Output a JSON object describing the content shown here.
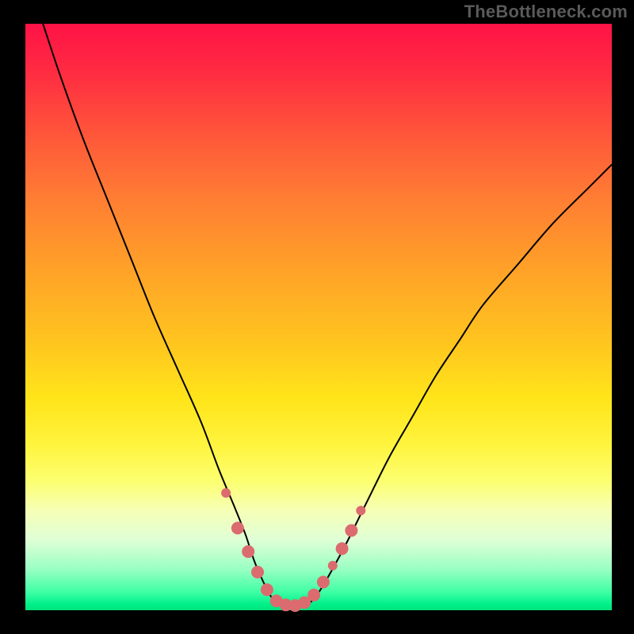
{
  "attribution": "TheBottleneck.com",
  "chart_data": {
    "type": "line",
    "title": "",
    "xlabel": "",
    "ylabel": "",
    "xlim": [
      0,
      100
    ],
    "ylim": [
      0,
      100
    ],
    "grid": false,
    "legend": false,
    "series": [
      {
        "name": "bottleneck-curve",
        "x": [
          3,
          6,
          10,
          14,
          18,
          22,
          26,
          30,
          33,
          35.5,
          37.5,
          39,
          40.5,
          42,
          44,
          46,
          48,
          50,
          54,
          58,
          62,
          66,
          70,
          74,
          78,
          84,
          90,
          96,
          100
        ],
        "y": [
          100,
          91,
          80,
          70,
          60,
          50,
          41,
          32,
          24,
          18,
          13,
          8.5,
          5,
          2.2,
          0.8,
          0.6,
          1.0,
          3.0,
          10,
          18,
          26,
          33,
          40,
          46,
          52,
          59,
          66,
          72,
          76
        ],
        "color": "#000000",
        "stroke_width": 2
      }
    ],
    "markers": [
      {
        "x": 34.2,
        "y": 20,
        "r": 6,
        "color": "#db6b6f"
      },
      {
        "x": 36.2,
        "y": 14,
        "r": 8,
        "color": "#db6b6f"
      },
      {
        "x": 38.0,
        "y": 10,
        "r": 8,
        "color": "#db6b6f"
      },
      {
        "x": 39.6,
        "y": 6.5,
        "r": 8,
        "color": "#db6b6f"
      },
      {
        "x": 41.2,
        "y": 3.5,
        "r": 8,
        "color": "#db6b6f"
      },
      {
        "x": 42.8,
        "y": 1.6,
        "r": 8,
        "color": "#db6b6f"
      },
      {
        "x": 44.4,
        "y": 0.9,
        "r": 8,
        "color": "#db6b6f"
      },
      {
        "x": 46.0,
        "y": 0.8,
        "r": 8,
        "color": "#db6b6f"
      },
      {
        "x": 47.6,
        "y": 1.3,
        "r": 8,
        "color": "#db6b6f"
      },
      {
        "x": 49.2,
        "y": 2.6,
        "r": 8,
        "color": "#db6b6f"
      },
      {
        "x": 50.8,
        "y": 4.8,
        "r": 8,
        "color": "#db6b6f"
      },
      {
        "x": 52.4,
        "y": 7.6,
        "r": 6,
        "color": "#db6b6f"
      },
      {
        "x": 54.0,
        "y": 10.5,
        "r": 8,
        "color": "#db6b6f"
      },
      {
        "x": 55.6,
        "y": 13.6,
        "r": 8,
        "color": "#db6b6f"
      },
      {
        "x": 57.2,
        "y": 17,
        "r": 6,
        "color": "#db6b6f"
      }
    ]
  }
}
